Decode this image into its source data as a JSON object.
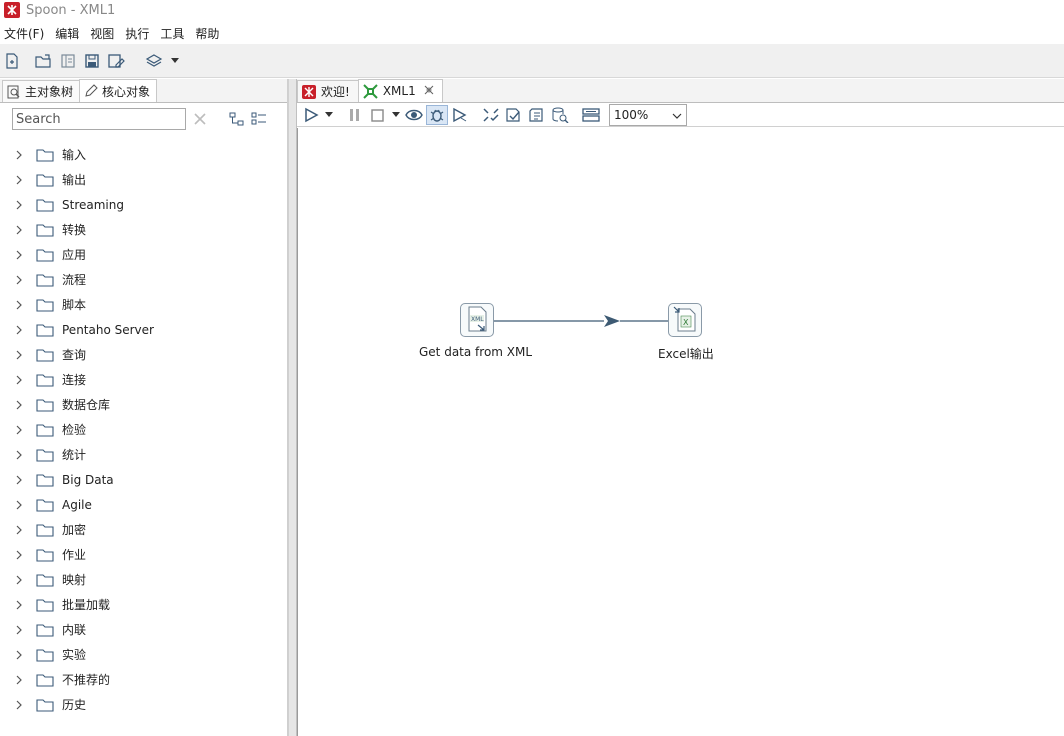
{
  "window": {
    "title": "Spoon - XML1"
  },
  "menubar": [
    "文件(F)",
    "编辑",
    "视图",
    "执行",
    "工具",
    "帮助"
  ],
  "left_panel": {
    "tabs": [
      {
        "label": "主对象树",
        "icon": "magnifier-icon"
      },
      {
        "label": "核心对象",
        "icon": "pencil-icon"
      }
    ],
    "search": {
      "placeholder": "Search",
      "value": ""
    },
    "tree_items": [
      "输入",
      "输出",
      "Streaming",
      "转换",
      "应用",
      "流程",
      "脚本",
      "Pentaho Server",
      "查询",
      "连接",
      "数据仓库",
      "检验",
      "统计",
      "Big Data",
      "Agile",
      "加密",
      "作业",
      "映射",
      "批量加载",
      "内联",
      "实验",
      "不推荐的",
      "历史"
    ]
  },
  "doc_tabs": [
    {
      "label": "欢迎!",
      "icon": "spoon-icon"
    },
    {
      "label": "XML1",
      "icon": "transformation-icon",
      "closable": true
    }
  ],
  "transformation_toolbar": {
    "zoom": "100%"
  },
  "canvas": {
    "steps": [
      {
        "name": "Get data from XML",
        "icon": "xml-input-icon"
      },
      {
        "name": "Excel输出",
        "icon": "excel-output-icon"
      }
    ],
    "hops": [
      {
        "from": "Get data from XML",
        "to": "Excel输出"
      }
    ]
  },
  "colors": {
    "hop": "#3d5a73",
    "brand_red": "#c8202a",
    "trans_green": "#2e9a3e"
  }
}
